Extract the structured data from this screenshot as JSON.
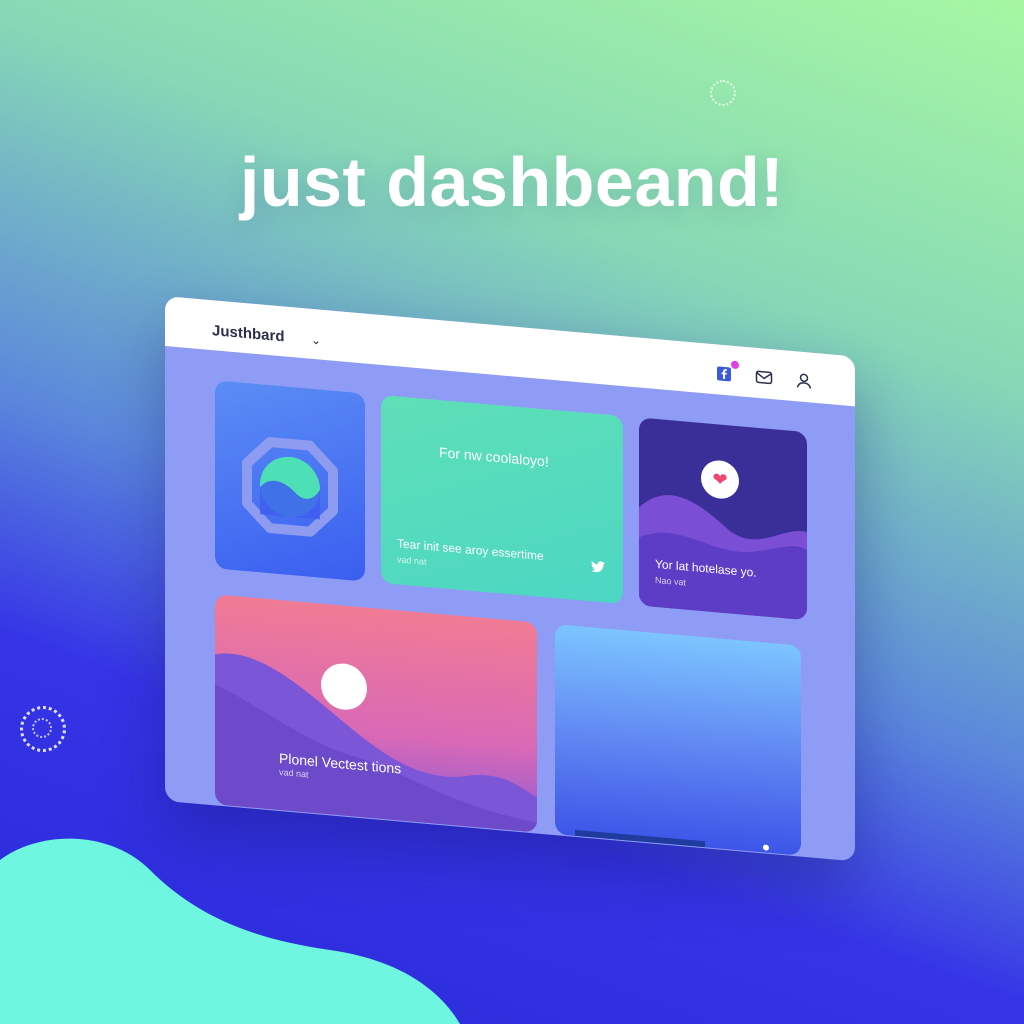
{
  "headline": "just dashbeand!",
  "window": {
    "app_name": "Justhbard",
    "app_menu_icon": "chevron-down-icon",
    "toolbar_icons": [
      "facebook-icon",
      "mail-icon",
      "user-icon"
    ]
  },
  "cards": {
    "green": {
      "title": "For nw coolaloyo!",
      "subtitle": "Tear init see aroy essertime",
      "meta": "vad nat",
      "icon": "twitter-icon"
    },
    "purple": {
      "title": "Yor lat hotelase yo.",
      "meta": "Nao vat",
      "icon": "heart-icon"
    },
    "sunset": {
      "title": "Plonel Vectest tions",
      "meta": "vad nat"
    }
  },
  "colors": {
    "accent_green": "#5ee0b7",
    "accent_purple": "#3a2f99",
    "accent_pink": "#f07b94",
    "notification_dot": "#e13ee5"
  }
}
